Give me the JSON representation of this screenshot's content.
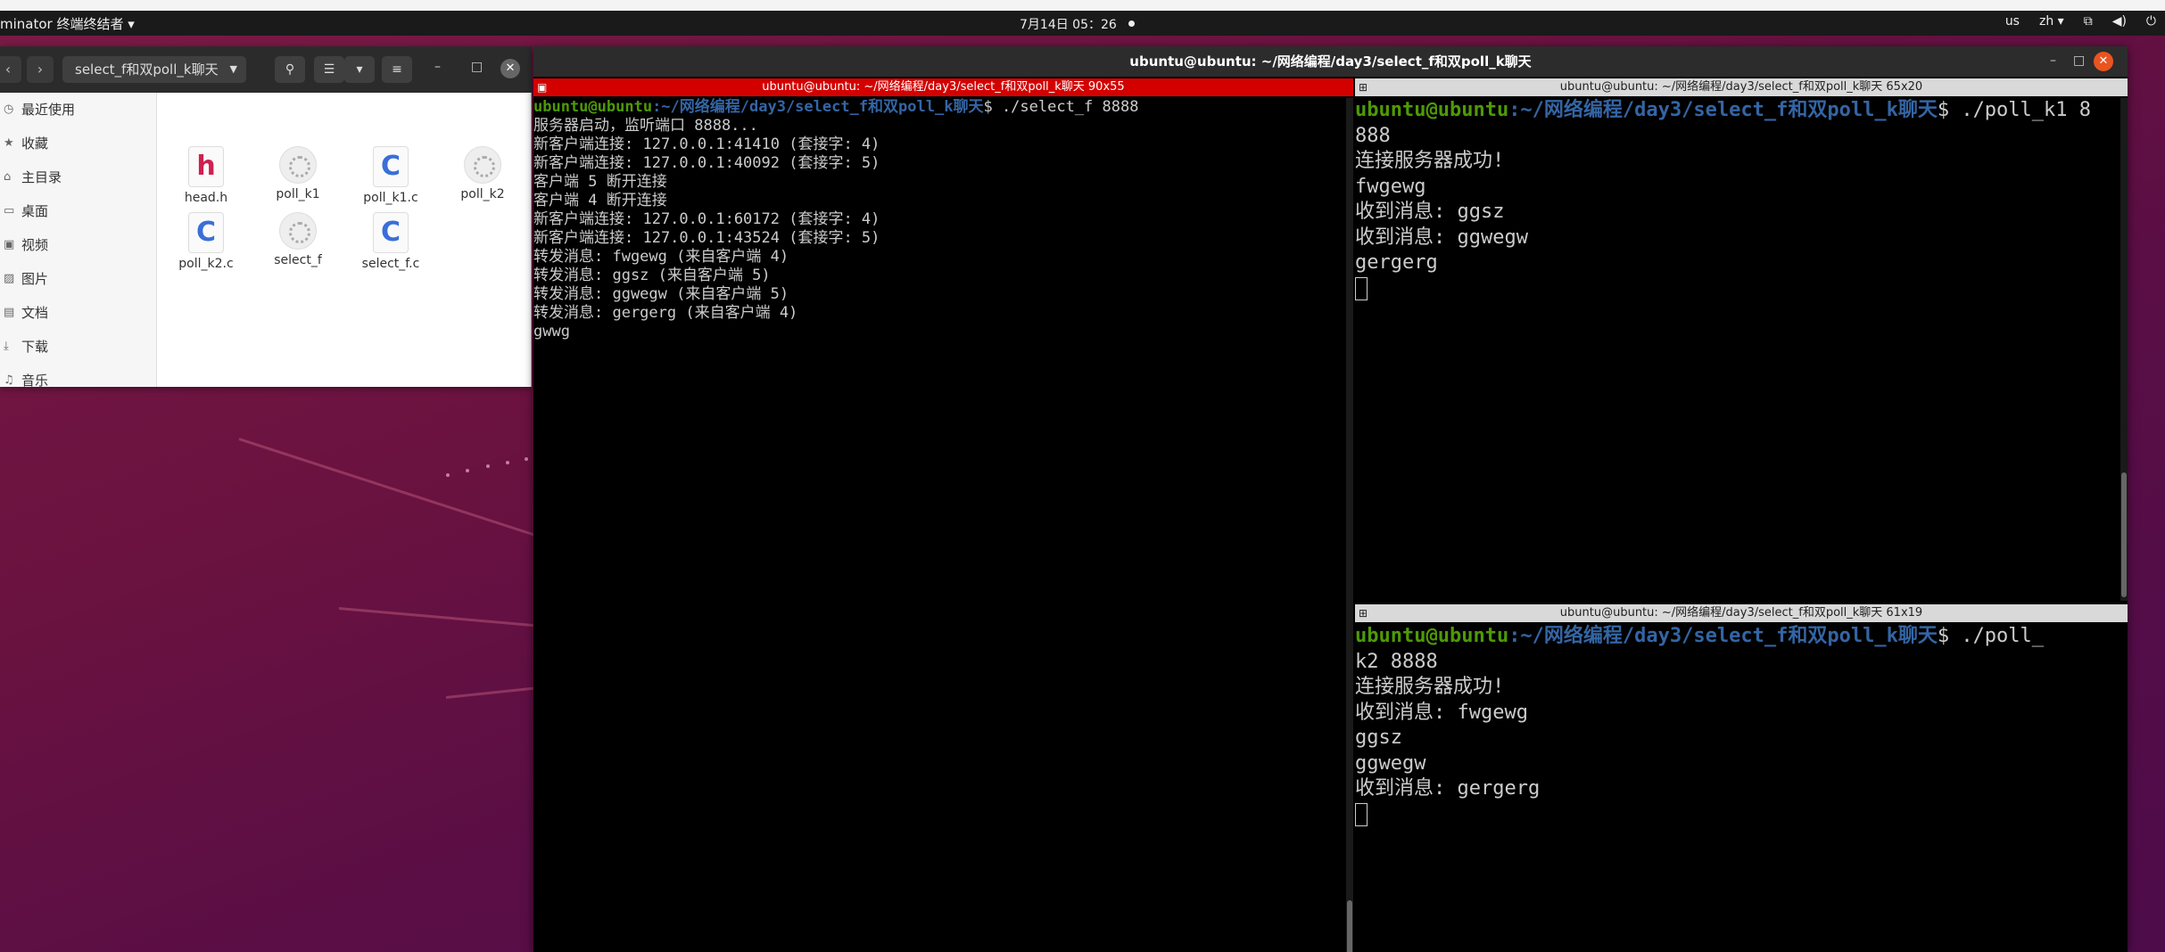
{
  "topbar": {
    "app_name": "minator 终端终结者 ▾",
    "clock": "7月14日 05：26",
    "tray": [
      "us",
      "zh ▾",
      "network",
      "volume",
      "power"
    ]
  },
  "files": {
    "back_icon": "chevron-left-icon",
    "forward_icon": "chevron-right-icon",
    "path": "select_f和双poll_k聊天",
    "sidebar": [
      {
        "label": "最近使用",
        "icon": "clock-icon"
      },
      {
        "label": "收藏",
        "icon": "star-icon"
      },
      {
        "label": "主目录",
        "icon": "home-icon"
      },
      {
        "label": "桌面",
        "icon": "desktop-icon"
      },
      {
        "label": "视频",
        "icon": "video-icon"
      },
      {
        "label": "图片",
        "icon": "picture-icon"
      },
      {
        "label": "文档",
        "icon": "document-icon"
      },
      {
        "label": "下载",
        "icon": "download-icon"
      },
      {
        "label": "音乐",
        "icon": "music-icon"
      }
    ],
    "items": [
      {
        "name": "head.h",
        "type": "h",
        "glyph": "h"
      },
      {
        "name": "poll_k1",
        "type": "exe",
        "glyph": ""
      },
      {
        "name": "poll_k1.c",
        "type": "c",
        "glyph": "C"
      },
      {
        "name": "poll_k2",
        "type": "exe",
        "glyph": ""
      },
      {
        "name": "poll_k2.c",
        "type": "c",
        "glyph": "C"
      },
      {
        "name": "select_f",
        "type": "exe",
        "glyph": ""
      },
      {
        "name": "select_f.c",
        "type": "c",
        "glyph": "C"
      }
    ]
  },
  "terminal": {
    "window_title": "ubuntu@ubuntu: ~/网络编程/day3/select_f和双poll_k聊天",
    "left": {
      "title": "ubuntu@ubuntu: ~/网络编程/day3/select_f和双poll_k聊天 90x55",
      "prompt_user": "ubuntu@ubuntu",
      "prompt_path": ":~/网络编程/day3/select_f和双poll_k聊天",
      "prompt_cmd": "$ ./select_f 8888",
      "lines": [
        "服务器启动，监听端口 8888...",
        "新客户端连接: 127.0.0.1:41410 (套接字: 4)",
        "新客户端连接: 127.0.0.1:40092 (套接字: 5)",
        "客户端 5 断开连接",
        "客户端 4 断开连接",
        "新客户端连接: 127.0.0.1:60172 (套接字: 4)",
        "新客户端连接: 127.0.0.1:43524 (套接字: 5)",
        "转发消息: fwgewg (来自客户端 4)",
        "转发消息: ggsz (来自客户端 5)",
        "转发消息: ggwegw (来自客户端 5)",
        "转发消息: gergerg (来自客户端 4)",
        "gwwg"
      ]
    },
    "right_top": {
      "title": "ubuntu@ubuntu: ~/网络编程/day3/select_f和双poll_k聊天 65x20",
      "prompt_user": "ubuntu@ubuntu",
      "prompt_path": ":~/网络编程/day3/select_f和双poll_k聊天",
      "prompt_cmd": "$ ./poll_k1 8",
      "wrap": "888",
      "lines": [
        "连接服务器成功!",
        "fwgewg",
        "收到消息: ggsz",
        "收到消息: ggwegw",
        "gergerg"
      ]
    },
    "right_bottom": {
      "title": "ubuntu@ubuntu: ~/网络编程/day3/select_f和双poll_k聊天 61x19",
      "prompt_user": "ubuntu@ubuntu",
      "prompt_path": ":~/网络编程/day3/select_f和双poll_k聊天",
      "prompt_cmd": "$ ./poll_",
      "wrap": "k2 8888",
      "lines": [
        "连接服务器成功!",
        "收到消息: fwgewg",
        "ggsz",
        "ggwegw",
        "收到消息: gergerg"
      ]
    }
  }
}
